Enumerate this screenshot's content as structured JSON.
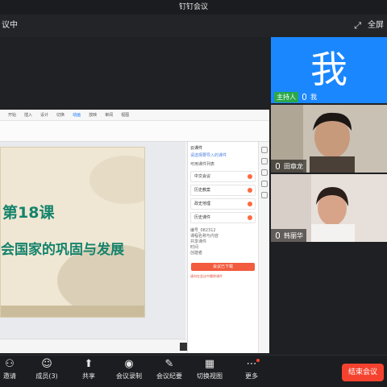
{
  "window": {
    "title": "钉钉会议"
  },
  "meeting_bar": {
    "status": "议中",
    "fullscreen_label": "全屏"
  },
  "shared_screen": {
    "ribbon_tabs": [
      "开始",
      "插入",
      "设计",
      "切换",
      "动画",
      "放映",
      "审阅",
      "视图"
    ],
    "slide": {
      "lesson": "第18课",
      "title": "会国家的巩固与发展"
    },
    "panel": {
      "header": "云课件",
      "link": "请选择要导入的课件",
      "section": "可用课件列表",
      "items": [
        "中文会议",
        "历史教案",
        "政史地理",
        "历史课件"
      ],
      "info": [
        "编号_082312",
        "课程名称与内容",
        "共享课件",
        "时间",
        "创建者"
      ],
      "cta": "会议已下载",
      "warning": "请勿在会议中删除课件"
    }
  },
  "participants": [
    {
      "avatar_text": "我",
      "role": "主持人",
      "name": "我"
    },
    {
      "name": "田章龙"
    },
    {
      "name": "韩丽华"
    }
  ],
  "toolbar": {
    "invite": "邀请",
    "members": "成员(3)",
    "share": "共享",
    "record": "会议录制",
    "minutes": "会议纪要",
    "switch_view": "切换视图",
    "more": "更多",
    "end": "结束会议"
  }
}
